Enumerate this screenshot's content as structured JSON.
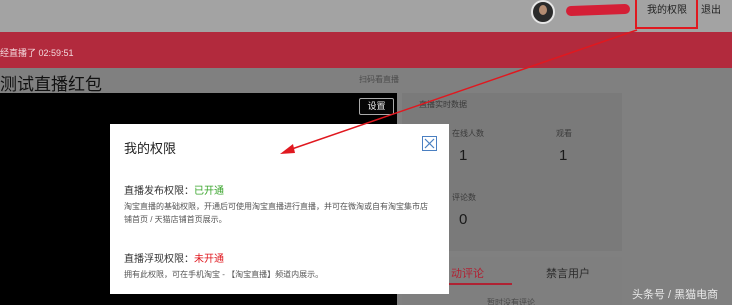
{
  "header": {
    "my_permissions": "我的权限",
    "logout": "退出"
  },
  "status_bar": {
    "text": "经直播了 02:59:51"
  },
  "main": {
    "title": "测试直播红包",
    "scan_label": "扫码看直播",
    "settings_button": "设置"
  },
  "realtime": {
    "title": "直播实时数据",
    "stats": [
      {
        "label": "在线人数",
        "value": "1"
      },
      {
        "label": "观看",
        "value": "1"
      },
      {
        "label": "评论数",
        "value": "0"
      }
    ]
  },
  "tabs": {
    "items": [
      "动评论",
      "禁言用户"
    ],
    "subtext": "暂时没有评论"
  },
  "modal": {
    "title": "我的权限",
    "permissions": [
      {
        "name": "直播发布权限：",
        "status": "已开通",
        "status_color": "#3aa52c",
        "desc": "淘宝直播的基础权限，开通后可使用淘宝直播进行直播，并可在微淘或自有淘宝集市店铺首页 / 天猫店铺首页展示。"
      },
      {
        "name": "直播浮现权限：",
        "status": "未开通",
        "status_color": "#e0181f",
        "desc": "拥有此权限，可在手机淘宝 - 【淘宝直播】频道内展示。"
      }
    ]
  },
  "watermark": "头条号 / 黑猫电商",
  "colors": {
    "accent": "#b02233",
    "annotation": "#e0181f"
  }
}
